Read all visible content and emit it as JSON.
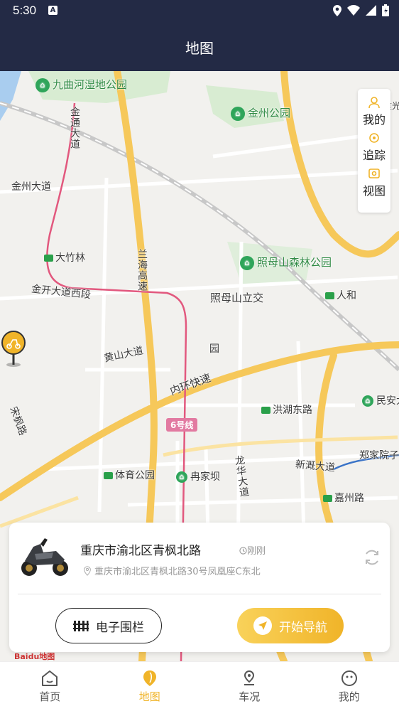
{
  "status_bar": {
    "time": "5:30",
    "a_badge": "A"
  },
  "header": {
    "title": "地图"
  },
  "map": {
    "labels": {
      "jiuqu": "九曲河湿地公园",
      "jinzhou_park": "金州公园",
      "jintong": "金通大道",
      "jinzhou_ave": "金州大道",
      "dazhulin": "大竹林",
      "lanhai": "兰海高速",
      "zhaomushan_park": "照母山森林公园",
      "jinkai": "金开大道西段",
      "zhaomushan_jct": "照母山立交",
      "renhe": "人和",
      "huangshan": "黄山大道",
      "yuan": "园",
      "neihuan": "内环快速",
      "minan": "民安大",
      "honghu": "洪湖东路",
      "line6": "6号线",
      "zongfeng": "宋枫路",
      "tiyu": "体育公园",
      "ranjiaba": "冉家坝",
      "longhua": "龙华大道",
      "xinliu": "新溉大道",
      "zhengjia": "郑家院子",
      "jiazhou": "嘉州路",
      "chongguang": "重光"
    }
  },
  "side_panel": {
    "items": [
      {
        "label": "我的",
        "icon": "person-icon"
      },
      {
        "label": "追踪",
        "icon": "track-icon"
      },
      {
        "label": "视图",
        "icon": "view-icon"
      }
    ]
  },
  "info_card": {
    "address_main": "重庆市渝北区青枫北路",
    "time_ago": "刚刚",
    "address_detail": "重庆市渝北区青枫北路30号凤凰座C东北",
    "fence_button": "电子围栏",
    "nav_button": "开始导航"
  },
  "baidu_logo": "Baidu地图",
  "tabs": [
    {
      "label": "首页",
      "icon": "home-icon",
      "active": false
    },
    {
      "label": "地图",
      "icon": "map-pin-icon",
      "active": true
    },
    {
      "label": "车况",
      "icon": "vehicle-status-icon",
      "active": false
    },
    {
      "label": "我的",
      "icon": "profile-icon",
      "active": false
    }
  ],
  "colors": {
    "header_bg": "#232a45",
    "accent": "#f0b429",
    "route_pink": "#e2587e",
    "highway": "#f6c85a"
  }
}
